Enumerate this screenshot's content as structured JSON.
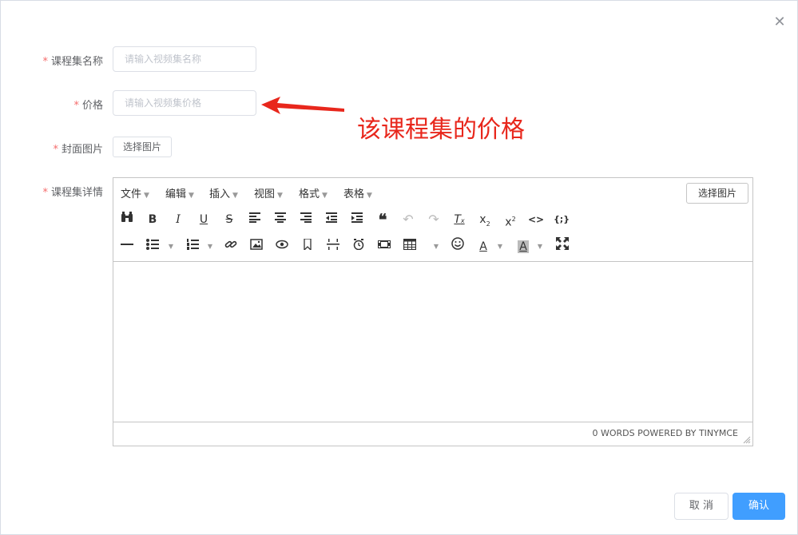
{
  "dialog": {
    "close_icon": "close-icon"
  },
  "form": {
    "required_mark": "*",
    "course_set_name": {
      "label": "课程集名称",
      "placeholder": "请输入视频集名称",
      "value": ""
    },
    "price": {
      "label": "价格",
      "placeholder": "请输入视频集价格",
      "value": ""
    },
    "cover_image": {
      "label": "封面图片",
      "button": "选择图片"
    },
    "details": {
      "label": "课程集详情"
    }
  },
  "annotation": {
    "text": "该课程集的价格",
    "color": "#e8271c"
  },
  "editor": {
    "menus": [
      "文件",
      "编辑",
      "插入",
      "视图",
      "格式",
      "表格"
    ],
    "select_image_button": "选择图片",
    "toolbar_row1": [
      "find-replace-icon",
      "bold-icon",
      "italic-icon",
      "underline-icon",
      "strikethrough-icon",
      "align-left-icon",
      "align-center-icon",
      "align-right-icon",
      "outdent-icon",
      "indent-icon",
      "blockquote-icon",
      "undo-icon",
      "redo-icon",
      "remove-format-icon",
      "subscript-icon",
      "superscript-icon",
      "code-icon",
      "code-sample-icon"
    ],
    "toolbar_row2": [
      "horizontal-rule-icon",
      "bullet-list-icon",
      "numbered-list-icon",
      "link-icon",
      "image-icon",
      "preview-icon",
      "bookmark-icon",
      "page-break-icon",
      "insert-datetime-icon",
      "media-icon",
      "table-icon",
      "emoticons-icon",
      "text-color-icon",
      "background-color-icon",
      "fullscreen-icon"
    ],
    "status": "0 WORDS POWERED BY TINYMCE"
  },
  "footer": {
    "cancel": "取 消",
    "confirm": "确认"
  },
  "colors": {
    "primary": "#409eff",
    "required": "#f56c6c",
    "border": "#dcdfe6"
  }
}
